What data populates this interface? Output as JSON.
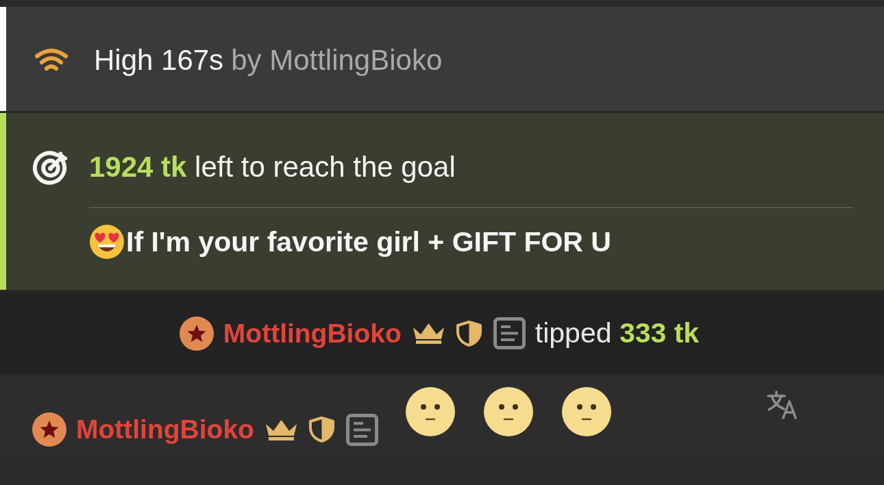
{
  "status": {
    "title": "High 167s",
    "byline": "by MottlingBioko"
  },
  "goal": {
    "progress_text": "**1924 tk** left to reach the goal",
    "description": "If I'm your favorite girl + GIFT FOR U"
  },
  "tip_notice": {
    "user": {
      "name": "MottlingBioko",
      "badges": [
        {
          "kind": "crown"
        },
        {
          "kind": "shield"
        },
        {
          "kind": "note"
        }
      ]
    },
    "action": "tipped **333 tk**"
  },
  "messages": [
    {
      "user": {
        "name": "MottlingBioko",
        "badges": [
          {
            "kind": "crown"
          },
          {
            "kind": "shield"
          },
          {
            "kind": "note"
          }
        ]
      },
      "emotes": [
        {
          "kind": "neutral-face"
        },
        {
          "kind": "neutral-face"
        },
        {
          "kind": "neutral-face"
        }
      ]
    }
  ]
}
